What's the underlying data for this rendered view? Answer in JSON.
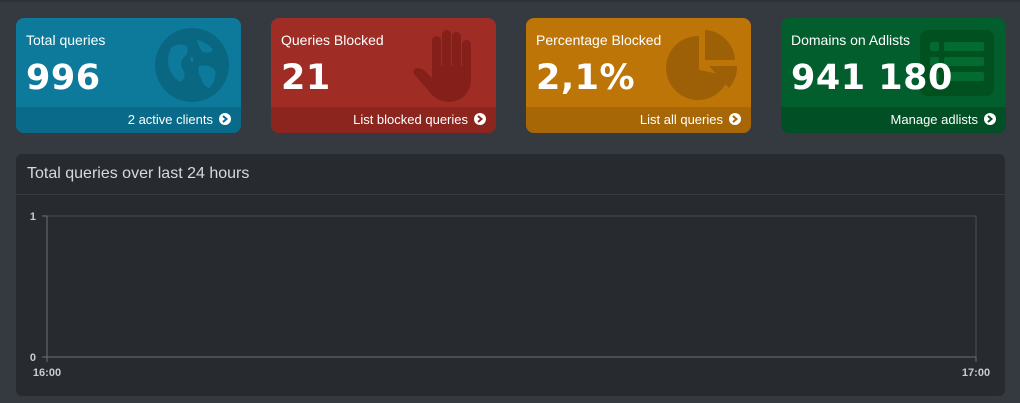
{
  "stats": [
    {
      "title": "Total queries",
      "value": "996",
      "footer": "2 active clients",
      "icon": "globe-icon",
      "color": "#0d7a9c"
    },
    {
      "title": "Queries Blocked",
      "value": "21",
      "footer": "List blocked queries",
      "icon": "hand-icon",
      "color": "#9f2c25"
    },
    {
      "title": "Percentage Blocked",
      "value": "2,1%",
      "footer": "List all queries",
      "icon": "pie-chart-icon",
      "color": "#be7508"
    },
    {
      "title": "Domains on Adlists",
      "value": "941 180",
      "footer": "Manage adlists",
      "icon": "list-icon",
      "color": "#025e2c"
    }
  ],
  "chart_panel": {
    "title": "Total queries over last 24 hours"
  },
  "chart_data": {
    "type": "line",
    "title": "",
    "xlabel": "",
    "ylabel": "",
    "x": [
      "16:00",
      "17:00"
    ],
    "y_ticks": [
      "0",
      "1"
    ],
    "ylim": [
      0,
      1
    ],
    "grid": false,
    "series": []
  }
}
